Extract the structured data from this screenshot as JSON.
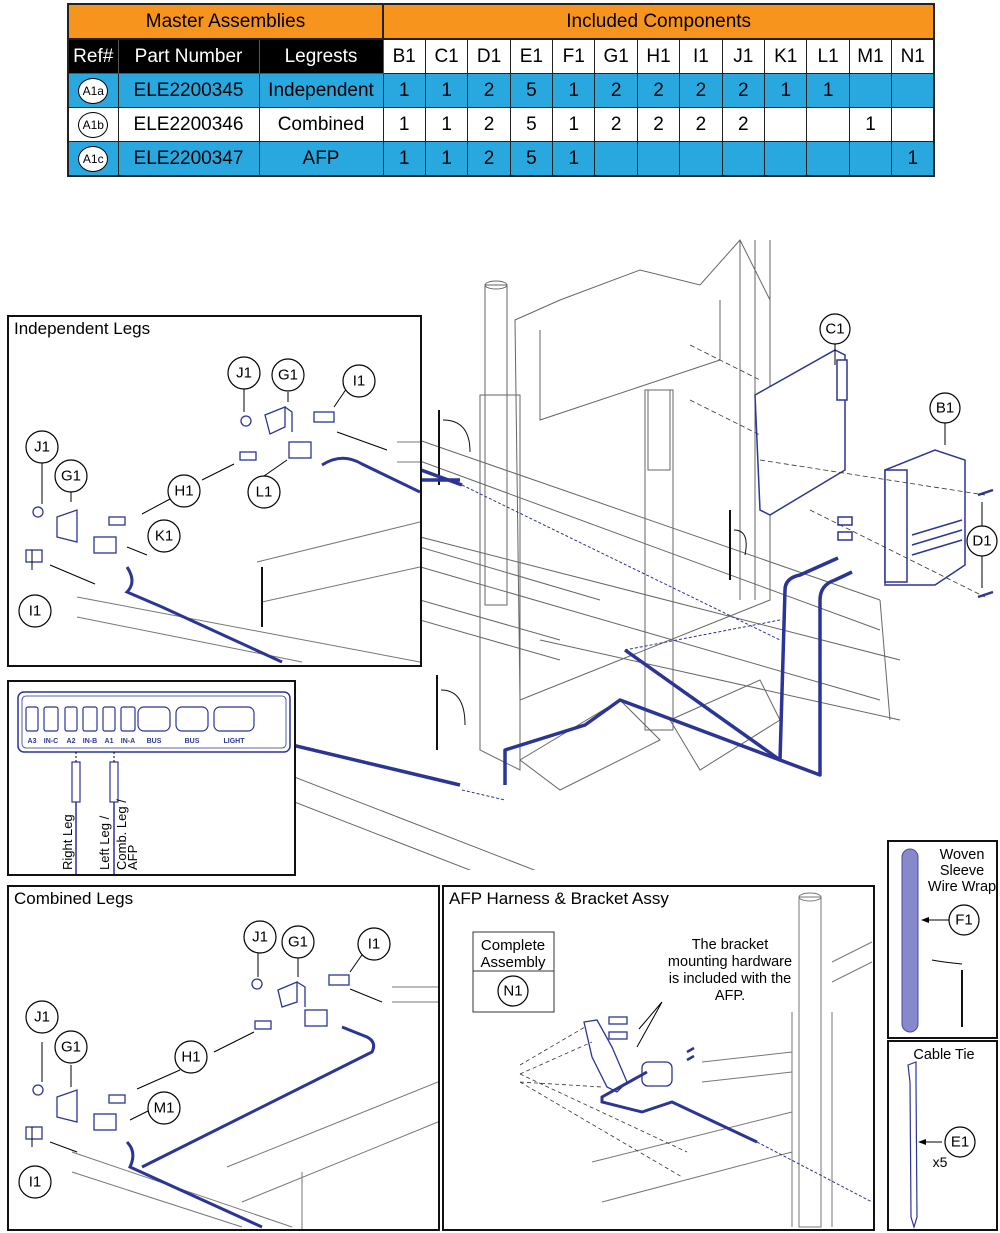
{
  "table": {
    "group_headers": {
      "master": "Master Assemblies",
      "included": "Included Components"
    },
    "columns": {
      "ref": "Ref#",
      "part_number": "Part Number",
      "legrests": "Legrests"
    },
    "component_columns": [
      "B1",
      "C1",
      "D1",
      "E1",
      "F1",
      "G1",
      "H1",
      "I1",
      "J1",
      "K1",
      "L1",
      "M1",
      "N1"
    ],
    "rows": [
      {
        "ref": "A1a",
        "part_number": "ELE2200345",
        "legrests": "Independent",
        "qty": [
          "1",
          "1",
          "2",
          "5",
          "1",
          "2",
          "2",
          "2",
          "2",
          "1",
          "1",
          "",
          ""
        ],
        "row_color": "#29a8e0"
      },
      {
        "ref": "A1b",
        "part_number": "ELE2200346",
        "legrests": "Combined",
        "qty": [
          "1",
          "1",
          "2",
          "5",
          "1",
          "2",
          "2",
          "2",
          "2",
          "",
          "",
          "1",
          ""
        ],
        "row_color": "#ffffff"
      },
      {
        "ref": "A1c",
        "part_number": "ELE2200347",
        "legrests": "AFP",
        "qty": [
          "1",
          "1",
          "2",
          "5",
          "1",
          "",
          "",
          "",
          "",
          "",
          "",
          "",
          "1"
        ],
        "row_color": "#29a8e0"
      }
    ]
  },
  "colors": {
    "header_orange": "#f7941d",
    "row_blue": "#29a8e0",
    "part_blue": "#2b3595",
    "outline": "#111111"
  },
  "main_view": {
    "callouts": {
      "c1": "C1",
      "b1": "B1",
      "d1": "D1"
    }
  },
  "panels": {
    "independent": {
      "title": "Independent Legs",
      "callouts": {
        "j1a": "J1",
        "g1a": "G1",
        "i1a": "I1",
        "h1": "H1",
        "l1": "L1",
        "j1b": "J1",
        "g1b": "G1",
        "k1": "K1",
        "i1b": "I1"
      }
    },
    "connector": {
      "ports": [
        "A3",
        "IN-C",
        "A2",
        "IN-B",
        "A1",
        "IN-A",
        "BUS",
        "BUS",
        "LIGHT"
      ],
      "leg_labels": {
        "right": "Right Leg",
        "left_line1": "Left Leg /",
        "left_line2": "Comb. Leg /",
        "left_line3": "AFP"
      }
    },
    "combined": {
      "title": "Combined Legs",
      "callouts": {
        "j1a": "J1",
        "g1a": "G1",
        "i1a": "I1",
        "h1": "H1",
        "j1b": "J1",
        "g1b": "G1",
        "m1": "M1",
        "i1b": "I1"
      }
    },
    "afp": {
      "title": "AFP Harness & Bracket Assy",
      "complete_label_1": "Complete",
      "complete_label_2": "Assembly",
      "complete_callout": "N1",
      "note": [
        "The bracket",
        "mounting hardware",
        "is included with the",
        "AFP."
      ]
    },
    "sleeve": {
      "title": [
        "Woven",
        "Sleeve",
        "Wire Wrap"
      ],
      "callout": "F1"
    },
    "cable_tie": {
      "title": "Cable Tie",
      "callout": "E1",
      "qty": "x5"
    }
  }
}
